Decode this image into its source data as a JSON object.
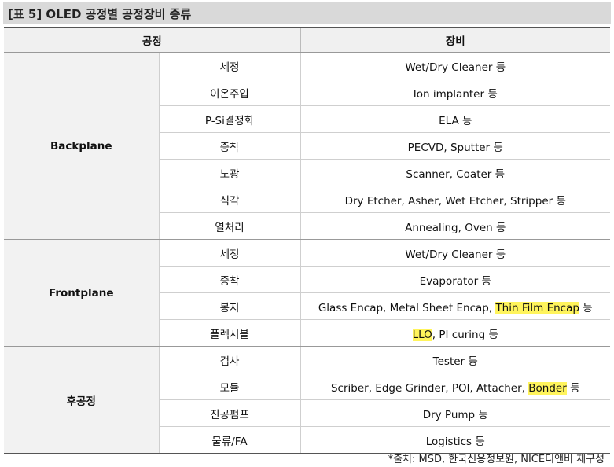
{
  "title": "[표 5] OLED 공정별 공정장비 종류",
  "headers": {
    "process": "공정",
    "equipment": "장비"
  },
  "groups": [
    {
      "name": "Backplane",
      "rows": [
        {
          "process": "세정",
          "equipment": [
            {
              "text": "Wet/Dry Cleaner 등"
            }
          ]
        },
        {
          "process": "이온주입",
          "equipment": [
            {
              "text": "Ion implanter 등"
            }
          ]
        },
        {
          "process": "P-Si결정화",
          "equipment": [
            {
              "text": "ELA 등"
            }
          ]
        },
        {
          "process": "증착",
          "equipment": [
            {
              "text": "PECVD, Sputter 등"
            }
          ]
        },
        {
          "process": "노광",
          "equipment": [
            {
              "text": "Scanner, Coater 등"
            }
          ]
        },
        {
          "process": "식각",
          "equipment": [
            {
              "text": "Dry Etcher, Asher, Wet Etcher, Stripper 등"
            }
          ]
        },
        {
          "process": "열처리",
          "equipment": [
            {
              "text": "Annealing, Oven 등"
            }
          ]
        }
      ]
    },
    {
      "name": "Frontplane",
      "rows": [
        {
          "process": "세정",
          "equipment": [
            {
              "text": "Wet/Dry Cleaner 등"
            }
          ]
        },
        {
          "process": "증착",
          "equipment": [
            {
              "text": "Evaporator 등"
            }
          ]
        },
        {
          "process": "봉지",
          "equipment": [
            {
              "text": "Glass Encap, Metal Sheet Encap, "
            },
            {
              "text": "Thin Film Encap",
              "highlight": true
            },
            {
              "text": " 등"
            }
          ]
        },
        {
          "process": "플렉시블",
          "equipment": [
            {
              "text": "LLO",
              "highlight": true
            },
            {
              "text": ", PI curing 등"
            }
          ]
        }
      ]
    },
    {
      "name": "후공정",
      "rows": [
        {
          "process": "검사",
          "equipment": [
            {
              "text": "Tester 등"
            }
          ]
        },
        {
          "process": "모듈",
          "equipment": [
            {
              "text": "Scriber, Edge Grinder, POl, Attacher, "
            },
            {
              "text": "Bonder",
              "highlight": true
            },
            {
              "text": " 등"
            }
          ]
        },
        {
          "process": "진공펌프",
          "equipment": [
            {
              "text": "Dry Pump 등"
            }
          ]
        },
        {
          "process": "물류/FA",
          "equipment": [
            {
              "text": "Logistics 등"
            }
          ]
        }
      ]
    }
  ],
  "highlight_color": "#fff45c",
  "source": "*출처: MSD, 한국신용정보원, NICE디앤비 재구성"
}
